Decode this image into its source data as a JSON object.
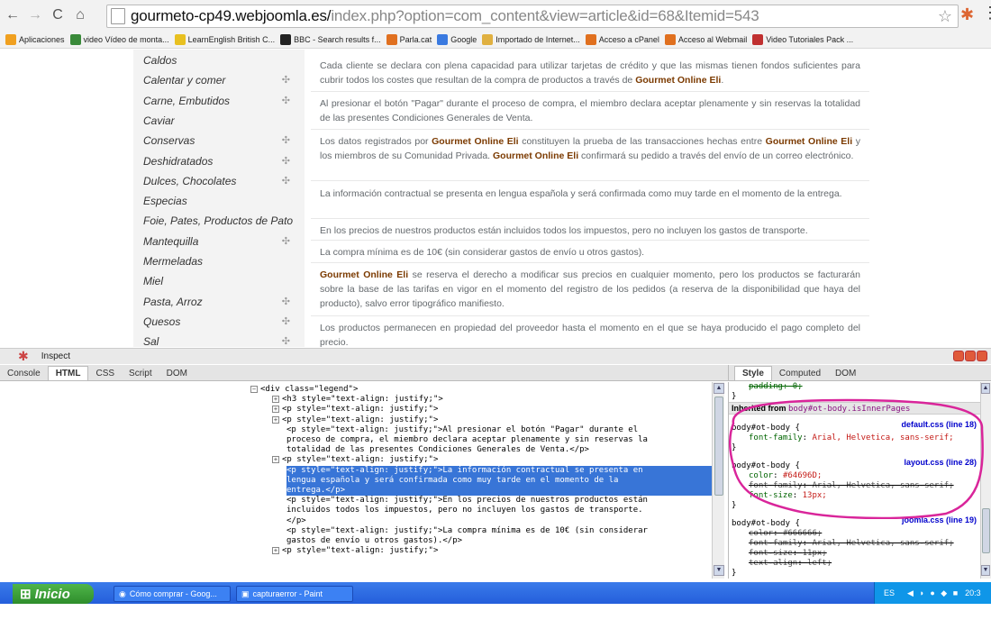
{
  "browser": {
    "url_domain": "gourmeto-cp49.webjoomla.es/",
    "url_path": "index.php?option=com_content&view=article&id=68&Itemid=543",
    "bookmarks": [
      "Aplicaciones",
      "video Vídeo de monta...",
      "LearnEnglish British C...",
      "BBC - Search results f...",
      "Parla.cat",
      "Google",
      "Importado de Internet...",
      "Acceso a cPanel",
      "Acceso al Webmail",
      "Video Tutoriales Pack ..."
    ]
  },
  "categories": [
    {
      "label": "Caldos",
      "plus": false
    },
    {
      "label": "Calentar y comer",
      "plus": true
    },
    {
      "label": "Carne, Embutidos",
      "plus": true
    },
    {
      "label": "Caviar",
      "plus": false
    },
    {
      "label": "Conservas",
      "plus": true
    },
    {
      "label": "Deshidratados",
      "plus": true
    },
    {
      "label": "Dulces, Chocolates",
      "plus": true
    },
    {
      "label": "Especias",
      "plus": false
    },
    {
      "label": "Foie, Pates, Productos de Pato",
      "plus": false
    },
    {
      "label": "Mantequilla",
      "plus": true
    },
    {
      "label": "Mermeladas",
      "plus": false
    },
    {
      "label": "Miel",
      "plus": false
    },
    {
      "label": "Pasta, Arroz",
      "plus": true
    },
    {
      "label": "Quesos",
      "plus": true
    },
    {
      "label": "Sal",
      "plus": true
    }
  ],
  "brand": "Gourmet Online Eli",
  "paragraphs": {
    "p1a": "Cada cliente se declara con plena capacidad para utilizar tarjetas de crédito y que las mismas tienen fondos suficientes para cubrir todos los costes que resultan de la compra de productos a través de ",
    "p1b": ".",
    "p2": "Al presionar el botón \"Pagar\" durante el proceso de compra, el miembro declara aceptar plenamente y sin reservas la totalidad de las presentes Condiciones Generales de Venta.",
    "p3a": "Los datos registrados por ",
    "p3b": " constituyen la prueba de las transacciones hechas entre ",
    "p3c": " y los miembros de su Comunidad Privada. ",
    "p3d": " confirmará su pedido a través del envío de un correo electrónico.",
    "p4": "La información contractual se presenta en lengua española y será confirmada como muy tarde en el momento de la entrega.",
    "p5": "En los precios de nuestros productos están incluidos todos los impuestos, pero no incluyen los gastos de transporte.",
    "p6": "La compra mínima es de 10€ (sin considerar gastos de envío u otros gastos).",
    "p7": " se reserva el derecho a modificar sus precios en cualquier momento, pero los productos se facturarán sobre la base de las tarifas en vigor en el momento del registro de los pedidos (a reserva de la disponibilidad que haya del producto), salvo error tipográfico manifiesto.",
    "p8": "Los productos permanecen en propiedad del proveedor hasta el momento en el que se haya producido el pago completo del precio."
  },
  "firebug": {
    "title": "Inspect",
    "tabs": [
      "Console",
      "HTML",
      "CSS",
      "Script",
      "DOM"
    ],
    "active_tab": "HTML",
    "side_tabs": [
      "Style",
      "Computed",
      "DOM"
    ],
    "active_side_tab": "Style",
    "html_lines": [
      {
        "indent": 48,
        "exp": "−",
        "text": "<div class=\"legend\">"
      },
      {
        "indent": 52,
        "exp": "+",
        "text": "<h3 style=\"text-align: justify;\">"
      },
      {
        "indent": 52,
        "exp": "+",
        "text": "<p style=\"text-align: justify;\">"
      },
      {
        "indent": 52,
        "exp": "+",
        "text": "<p style=\"text-align: justify;\">"
      },
      {
        "indent": 53,
        "exp": "",
        "text": "<p style=\"text-align: justify;\">Al presionar el botón \"Pagar\" durante el"
      },
      {
        "indent": 53,
        "exp": "",
        "text": "proceso de compra, el miembro declara aceptar plenamente y sin reservas la"
      },
      {
        "indent": 53,
        "exp": "",
        "text": "totalidad de las presentes Condiciones Generales de Venta.</p>"
      },
      {
        "indent": 52,
        "exp": "+",
        "text": "<p style=\"text-align: justify;\">"
      },
      {
        "indent": 53,
        "exp": "",
        "text": "<p style=\"text-align: justify;\">La información contractual se presenta en",
        "sel": true
      },
      {
        "indent": 53,
        "exp": "",
        "text": "lengua española y será confirmada como muy tarde en el momento de la",
        "sel": true
      },
      {
        "indent": 53,
        "exp": "",
        "text": "entrega.</p>",
        "sel": true
      },
      {
        "indent": 53,
        "exp": "",
        "text": "<p style=\"text-align: justify;\">En los precios de nuestros productos están"
      },
      {
        "indent": 53,
        "exp": "",
        "text": "incluidos todos los impuestos, pero no incluyen los gastos de transporte."
      },
      {
        "indent": 53,
        "exp": "",
        "text": "</p>"
      },
      {
        "indent": 53,
        "exp": "",
        "text": "<p style=\"text-align: justify;\">La compra mínima es de 10€ (sin considerar"
      },
      {
        "indent": 53,
        "exp": "",
        "text": "gastos de envío u otros gastos).</p>"
      },
      {
        "indent": 52,
        "exp": "+",
        "text": "<p style=\"text-align: justify;\">"
      }
    ],
    "style_panel": {
      "top_strike": "padding: 0;",
      "inherited_label": "Inherited from ",
      "inherited_selector": "body#ot-body.isInnerPages",
      "rules": [
        {
          "selector": "body#ot-body {",
          "source": "default.css (line 18)",
          "props": [
            {
              "p": "font-family",
              "v": "Arial, Helvetica, sans-serif;",
              "strike": false
            }
          ]
        },
        {
          "selector": "body#ot-body {",
          "source": "layout.css (line 28)",
          "props": [
            {
              "p": "color",
              "v": "#64696D;",
              "strike": false
            },
            {
              "p": "font-family",
              "v": "Arial, Helvetica, sans-serif;",
              "strike": true
            },
            {
              "p": "font-size",
              "v": "13px;",
              "strike": false
            }
          ]
        },
        {
          "selector": "body#ot-body {",
          "source": "joomla.css (line 19)",
          "props": [
            {
              "p": "color",
              "v": "#666666;",
              "strike": true
            },
            {
              "p": "font-family",
              "v": "Arial, Helvetica, sans-serif;",
              "strike": true
            },
            {
              "p": "font-size",
              "v": "11px;",
              "strike": true
            },
            {
              "p": "text-align",
              "v": "left;",
              "strike": true
            }
          ]
        }
      ]
    }
  },
  "taskbar": {
    "start_label": "Inicio",
    "tasks": [
      "Cómo comprar - Goog...",
      "capturaerror - Paint"
    ],
    "lang": "ES",
    "time": "20:3"
  },
  "colors": {
    "annotation": "#d9259a",
    "selection": "#3875d7",
    "brand_text": "#7b3a00"
  }
}
